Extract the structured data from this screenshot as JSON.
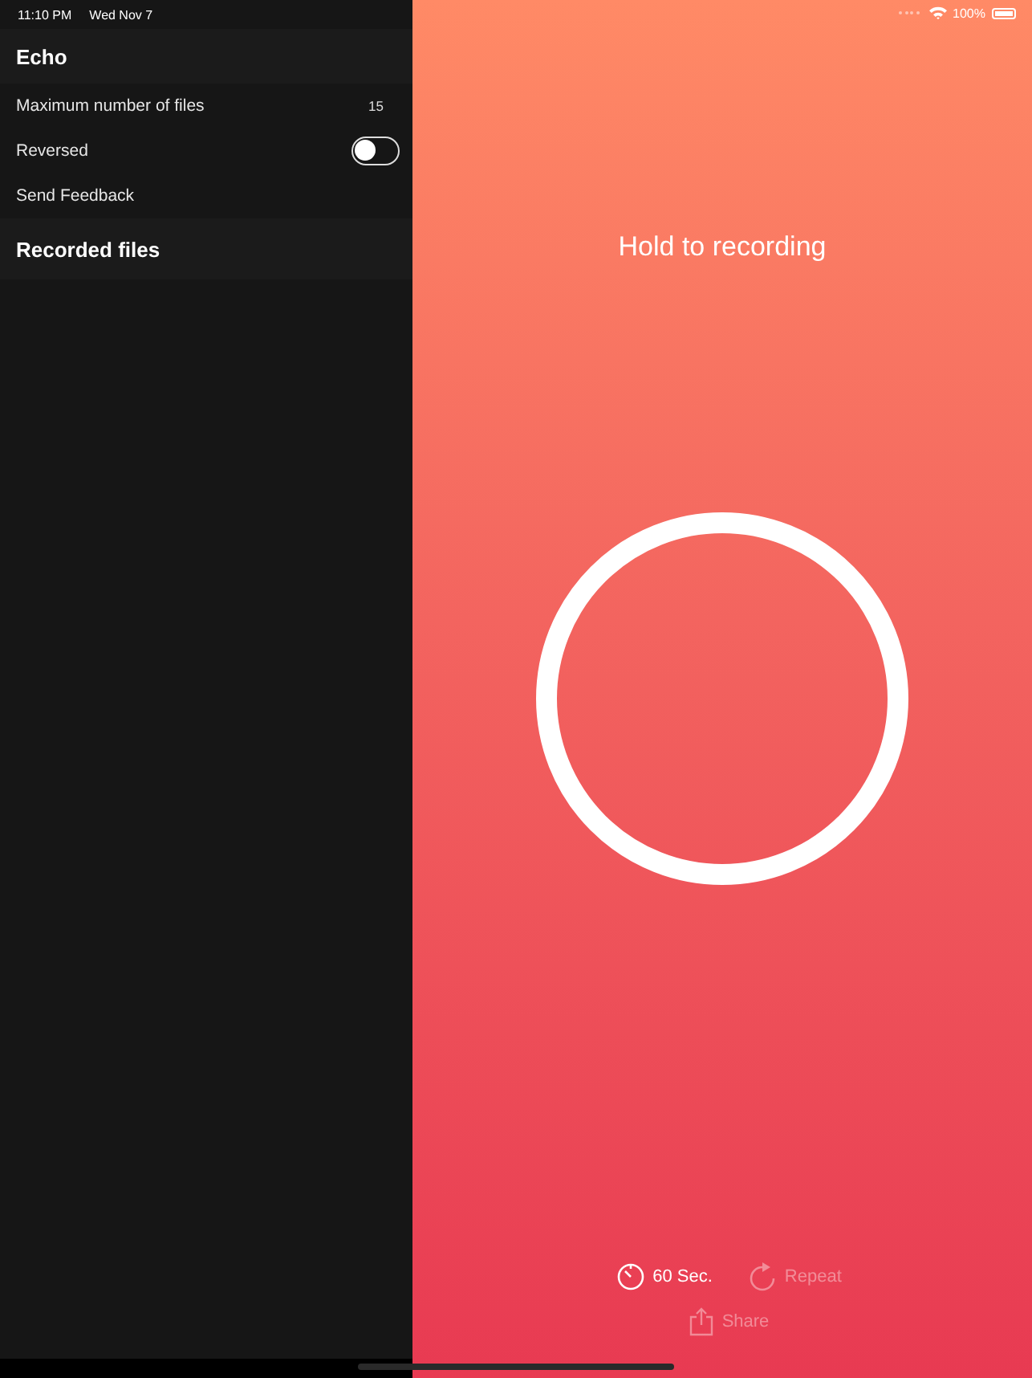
{
  "status_bar": {
    "time": "11:10 PM",
    "date": "Wed Nov 7",
    "battery": "100%"
  },
  "sidebar": {
    "title": "Echo",
    "settings": [
      {
        "kind": "value",
        "label": "Maximum number of files",
        "value": "15"
      },
      {
        "kind": "toggle",
        "label": "Reversed",
        "on": false
      },
      {
        "kind": "link",
        "label": "Send Feedback"
      }
    ],
    "section": "Recorded files"
  },
  "recorder": {
    "prompt": "Hold to recording",
    "controls": [
      {
        "kind": "timer",
        "label": "60 Sec.",
        "disabled": false
      },
      {
        "kind": "repeat",
        "label": "Repeat",
        "disabled": true
      },
      {
        "kind": "share",
        "label": "Share",
        "disabled": true
      }
    ]
  }
}
